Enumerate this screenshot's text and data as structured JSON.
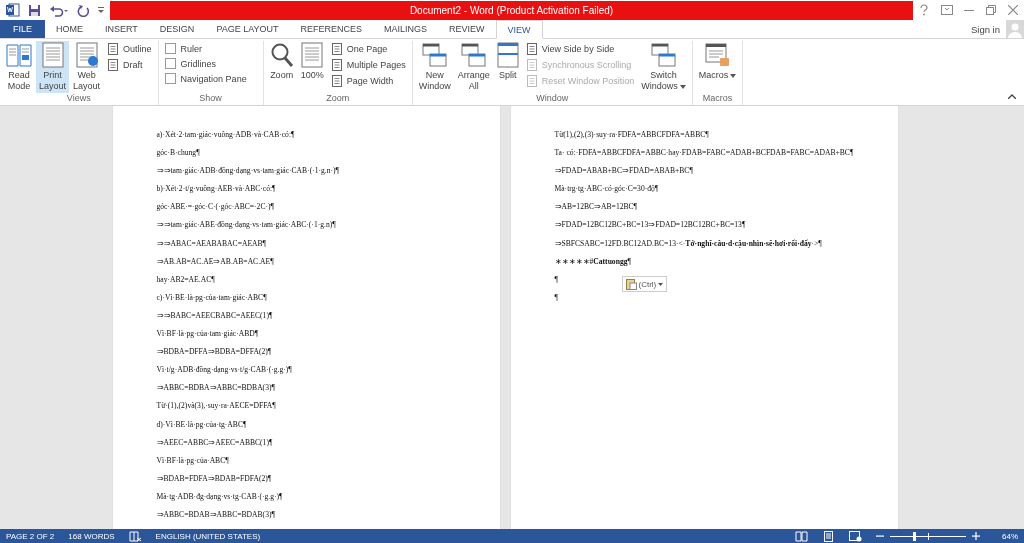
{
  "window": {
    "title": "Document2 - Word (Product Activation Failed)"
  },
  "tabs": [
    {
      "label": "FILE",
      "kind": "file",
      "selected": false
    },
    {
      "label": "HOME",
      "kind": "tab",
      "selected": false
    },
    {
      "label": "INSERT",
      "kind": "tab",
      "selected": false
    },
    {
      "label": "DESIGN",
      "kind": "tab",
      "selected": false
    },
    {
      "label": "PAGE LAYOUT",
      "kind": "tab",
      "selected": false
    },
    {
      "label": "REFERENCES",
      "kind": "tab",
      "selected": false
    },
    {
      "label": "MAILINGS",
      "kind": "tab",
      "selected": false
    },
    {
      "label": "REVIEW",
      "kind": "tab",
      "selected": false
    },
    {
      "label": "VIEW",
      "kind": "tab",
      "selected": true
    }
  ],
  "sign_in": "Sign in",
  "ribbon": {
    "groups": [
      {
        "label": "Views",
        "items": [
          {
            "kind": "large",
            "label": "Read\nMode",
            "selected": false
          },
          {
            "kind": "large",
            "label": "Print\nLayout",
            "selected": true
          },
          {
            "kind": "large",
            "label": "Web\nLayout",
            "selected": false
          },
          {
            "kind": "stack",
            "items": [
              {
                "label": "Outline",
                "disabled": false
              },
              {
                "label": "Draft",
                "disabled": false
              }
            ]
          }
        ]
      },
      {
        "label": "Show",
        "items": [
          {
            "kind": "checks",
            "items": [
              {
                "label": "Ruler",
                "checked": false
              },
              {
                "label": "Gridlines",
                "checked": false
              },
              {
                "label": "Navigation Pane",
                "checked": false
              }
            ]
          }
        ]
      },
      {
        "label": "Zoom",
        "items": [
          {
            "kind": "large",
            "label": "Zoom",
            "selected": false
          },
          {
            "kind": "large",
            "label": "100%",
            "selected": false
          },
          {
            "kind": "stack",
            "items": [
              {
                "label": "One Page",
                "disabled": false
              },
              {
                "label": "Multiple Pages",
                "disabled": false
              },
              {
                "label": "Page Width",
                "disabled": false
              }
            ]
          }
        ]
      },
      {
        "label": "Window",
        "items": [
          {
            "kind": "large",
            "label": "New\nWindow",
            "selected": false
          },
          {
            "kind": "large",
            "label": "Arrange\nAll",
            "selected": false
          },
          {
            "kind": "large",
            "label": "Split",
            "selected": false
          },
          {
            "kind": "stack",
            "items": [
              {
                "label": "View Side by Side",
                "disabled": false
              },
              {
                "label": "Synchronous Scrolling",
                "disabled": true
              },
              {
                "label": "Reset Window Position",
                "disabled": true
              }
            ]
          },
          {
            "kind": "large",
            "label": "Switch\nWindows",
            "selected": false,
            "dropdown": true
          }
        ]
      },
      {
        "label": "Macros",
        "items": [
          {
            "kind": "large",
            "label": "Macros",
            "selected": false,
            "dropdown": true
          }
        ]
      }
    ]
  },
  "pages": [
    {
      "lines": [
        "a)·Xét·2·tam·giác·vuông·ADB·và·CAB·có:¶",
        "góc·B·chung¶",
        "⇒⇒tam·giác·ADB·đồng·dạng·vs·tam·giác·CAB·(·1·g.n·)¶",
        "b)·Xét·2·t/g·vuông·AEB·và·ABC·có:¶",
        "góc·ABE·=·góc·C·(·góc·ABC=·2C·)¶",
        "⇒⇒tam·giác·ABE·đồng·dạng·vs·tam·giác·ABC·(·1·g.n)¶",
        "⇒⇒ABAC=AEABABAC=AEAB¶",
        "⇒AB.AB=AC.AE⇒AB.AB=AC.AE¶",
        "hay·AB2=AE.AC¶",
        "c)·Vì·BE·là·pg·của·tam·giác·ABC¶",
        "⇒⇒BABC=AEECBABC=AEEC(1)¶",
        "Vì·BF·là·pg·của·tam·giác·ABD¶",
        "⇒BDBA=DFFA⇒BDBA=DFFA(2)¶",
        "Vì·t/g·ADB·đồng·dạng·vs·t/g·CAB·(·g.g·)¶",
        "⇒ABBC=BDBA⇒ABBC=BDBA(3)¶",
        "Từ·(1),(2)và(3),·suy·ra·AECE=DFFA¶",
        "d)·Vì·BE·là·pg·của·tg·ABC¶",
        "⇒AEEC=ABBC⇒AEEC=ABBC(1)¶",
        "Vì·BF·là·pg·của·ABC¶",
        "⇒BDAB=FDFA⇒BDAB=FDFA(2)¶",
        "Mà·tg·ADB·đg·dạng·vs·tg·CAB·(·g.g·)¶",
        "⇒ABBC=BDAB⇒ABBC=BDAB(3)¶"
      ]
    },
    {
      "lines": [
        "Từ(1),(2),(3)·suy·ra·FDFA=ABBCFDFA=ABBC¶",
        "Ta· có:·FDFA=ABBCFDFA=ABBC·hay·FDAB=FABC=ADAB+BCFDAB=FABC=ADAB+BC¶",
        "⇒FDAD=ABAB+BC⇒FDAD=ABAB+BC¶",
        "Mà·trg·tg·ABC·có·góc·C=30·độ¶",
        "⇒AB=12BC⇒AB=12BC¶",
        "⇒FDAD=12BC12BC+BC=13⇒FDAD=12BC12BC+BC=13¶",
        "⇒SBFCSABC=12FD.BC12AD.BC=13·<·**Tớ·nghĩ·câu·d·cậu·nhìn·sẽ·hơi·rối·đấy**·>¶",
        "∗∗∗∗∗#**Cattuongg**¶",
        "¶",
        "¶"
      ],
      "paste_options": "(Ctrl)"
    }
  ],
  "status_bar": {
    "page": "PAGE 2 OF 2",
    "words": "168 WORDS",
    "language": "ENGLISH (UNITED STATES)",
    "zoom": {
      "level": 0.32,
      "reading": "64%"
    }
  }
}
